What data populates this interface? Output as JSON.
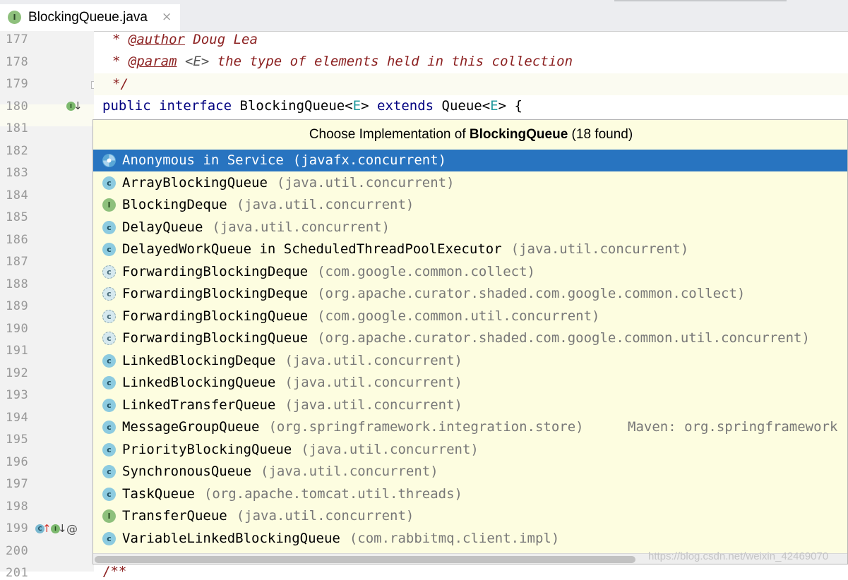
{
  "editor": {
    "tab": {
      "icon": "I",
      "title": "BlockingQueue.java",
      "close": "×"
    },
    "line_numbers": [
      "177",
      "178",
      "179",
      "180",
      "181",
      "182",
      "183",
      "184",
      "185",
      "186",
      "187",
      "188",
      "189",
      "190",
      "191",
      "192",
      "193",
      "194",
      "195",
      "196",
      "197",
      "198",
      "199",
      "200",
      "201"
    ],
    "code": {
      "line177": {
        "star": "* ",
        "tag": "@author",
        "text": " Doug Lea"
      },
      "line178": {
        "star": "* ",
        "tag": "@param",
        "text1": " <E> ",
        "text2": "the type of elements held in this collection"
      },
      "line179": {
        "text": "*/"
      },
      "line180": {
        "kw1": "public",
        "kw2": "interface",
        "name": "BlockingQueue<",
        "tp1": "E",
        "mid": "> ",
        "kw3": "extends",
        "name2": " Queue<",
        "tp2": "E",
        "end": "> {"
      },
      "line201": {
        "text": "/**"
      }
    },
    "gutter": {
      "mark_icon": "I",
      "class_icon": "C",
      "arrow_down": "↓",
      "arrow_up": "↑",
      "at": "@"
    }
  },
  "popup": {
    "header_prefix": "Choose Implementation of ",
    "header_class": "BlockingQueue",
    "header_suffix": " (18 found)",
    "items": [
      {
        "icon": "anon",
        "glyph": "",
        "name": "Anonymous in Service",
        "pkg": "(javafx.concurrent)"
      },
      {
        "icon": "class",
        "glyph": "c",
        "name": "ArrayBlockingQueue",
        "pkg": "(java.util.concurrent)"
      },
      {
        "icon": "interface",
        "glyph": "I",
        "name": "BlockingDeque",
        "pkg": "(java.util.concurrent)"
      },
      {
        "icon": "class",
        "glyph": "c",
        "name": "DelayQueue",
        "pkg": "(java.util.concurrent)"
      },
      {
        "icon": "class",
        "glyph": "c",
        "name": "DelayedWorkQueue in ScheduledThreadPoolExecutor",
        "pkg": "(java.util.concurrent)"
      },
      {
        "icon": "abstract",
        "glyph": "c",
        "name": "ForwardingBlockingDeque",
        "pkg": "(com.google.common.collect)"
      },
      {
        "icon": "abstract",
        "glyph": "c",
        "name": "ForwardingBlockingDeque",
        "pkg": "(org.apache.curator.shaded.com.google.common.collect)"
      },
      {
        "icon": "abstract",
        "glyph": "c",
        "name": "ForwardingBlockingQueue",
        "pkg": "(com.google.common.util.concurrent)"
      },
      {
        "icon": "abstract",
        "glyph": "c",
        "name": "ForwardingBlockingQueue",
        "pkg": "(org.apache.curator.shaded.com.google.common.util.concurrent)"
      },
      {
        "icon": "class",
        "glyph": "c",
        "name": "LinkedBlockingDeque",
        "pkg": "(java.util.concurrent)"
      },
      {
        "icon": "class",
        "glyph": "c",
        "name": "LinkedBlockingQueue",
        "pkg": "(java.util.concurrent)"
      },
      {
        "icon": "class",
        "glyph": "c",
        "name": "LinkedTransferQueue",
        "pkg": "(java.util.concurrent)"
      },
      {
        "icon": "class",
        "glyph": "c",
        "name": "MessageGroupQueue",
        "pkg": "(org.springframework.integration.store)",
        "location": "Maven: org.springframework"
      },
      {
        "icon": "class",
        "glyph": "c",
        "name": "PriorityBlockingQueue",
        "pkg": "(java.util.concurrent)"
      },
      {
        "icon": "class",
        "glyph": "c",
        "name": "SynchronousQueue",
        "pkg": "(java.util.concurrent)"
      },
      {
        "icon": "class",
        "glyph": "c",
        "name": "TaskQueue",
        "pkg": "(org.apache.tomcat.util.threads)"
      },
      {
        "icon": "interface",
        "glyph": "I",
        "name": "TransferQueue",
        "pkg": "(java.util.concurrent)"
      },
      {
        "icon": "class",
        "glyph": "c",
        "name": "VariableLinkedBlockingQueue",
        "pkg": "(com.rabbitmq.client.impl)"
      }
    ],
    "selected_index": 0
  },
  "watermark": "https://blog.csdn.net/weixin_42469070",
  "colors": {
    "selection": "#2874c0",
    "popup_bg": "#fdfde0",
    "keyword": "#000080",
    "comment": "#8c2121",
    "type_param": "#20999d"
  }
}
